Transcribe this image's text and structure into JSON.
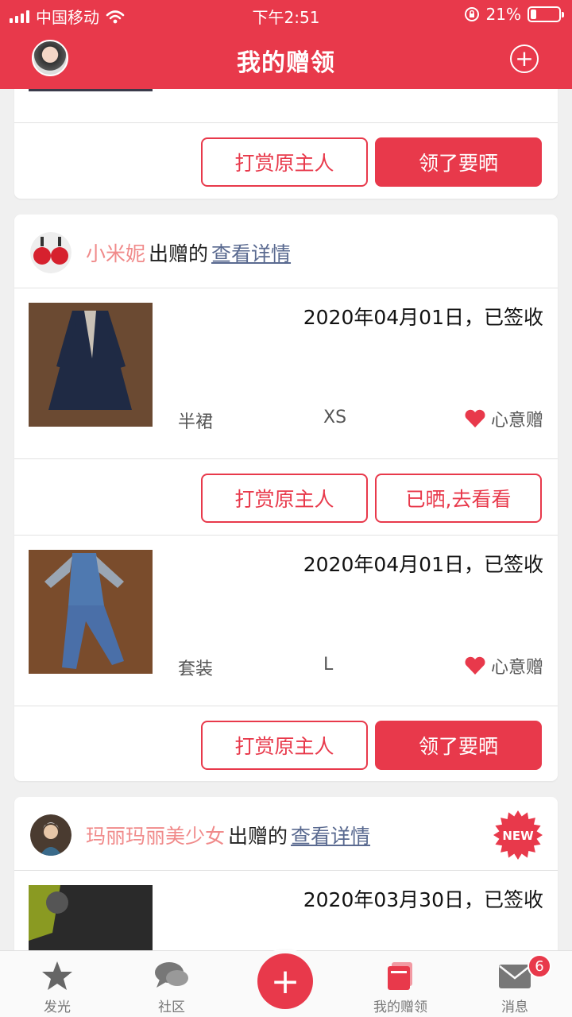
{
  "status_bar": {
    "carrier": "中国移动",
    "time": "下午2:51",
    "battery": "21%",
    "battery_level": 0.21
  },
  "nav": {
    "title": "我的赠领"
  },
  "cards": [
    {
      "partial": true,
      "buttons": {
        "reward": "打赏原主人",
        "action": "领了要晒"
      }
    },
    {
      "giver": "小米妮",
      "verb": "出赠的",
      "detail_link": "查看详情",
      "items": [
        {
          "date": "2020年04月01日，已签收",
          "category": "半裙",
          "size": "XS",
          "tag": "心意赠",
          "buttons": {
            "reward": "打赏原主人",
            "action": "已晒,去看看"
          }
        },
        {
          "date": "2020年04月01日，已签收",
          "category": "套装",
          "size": "L",
          "tag": "心意赠",
          "buttons": {
            "reward": "打赏原主人",
            "action": "领了要晒"
          }
        }
      ]
    },
    {
      "giver": "玛丽玛丽美少女",
      "verb": "出赠的",
      "detail_link": "查看详情",
      "badge": "NEW",
      "items": [
        {
          "date": "2020年03月30日，已签收"
        }
      ]
    }
  ],
  "tabs": [
    {
      "label": "发光",
      "icon": "star-icon"
    },
    {
      "label": "社区",
      "icon": "chat-bubbles-icon"
    },
    {
      "label": "",
      "icon": "plus-icon"
    },
    {
      "label": "我的赠领",
      "icon": "gift-cards-icon"
    },
    {
      "label": "消息",
      "icon": "envelope-icon",
      "badge": "6"
    }
  ],
  "colors": {
    "brand": "#e8394b",
    "giver": "#f08a8a",
    "link": "#5a6a90"
  }
}
